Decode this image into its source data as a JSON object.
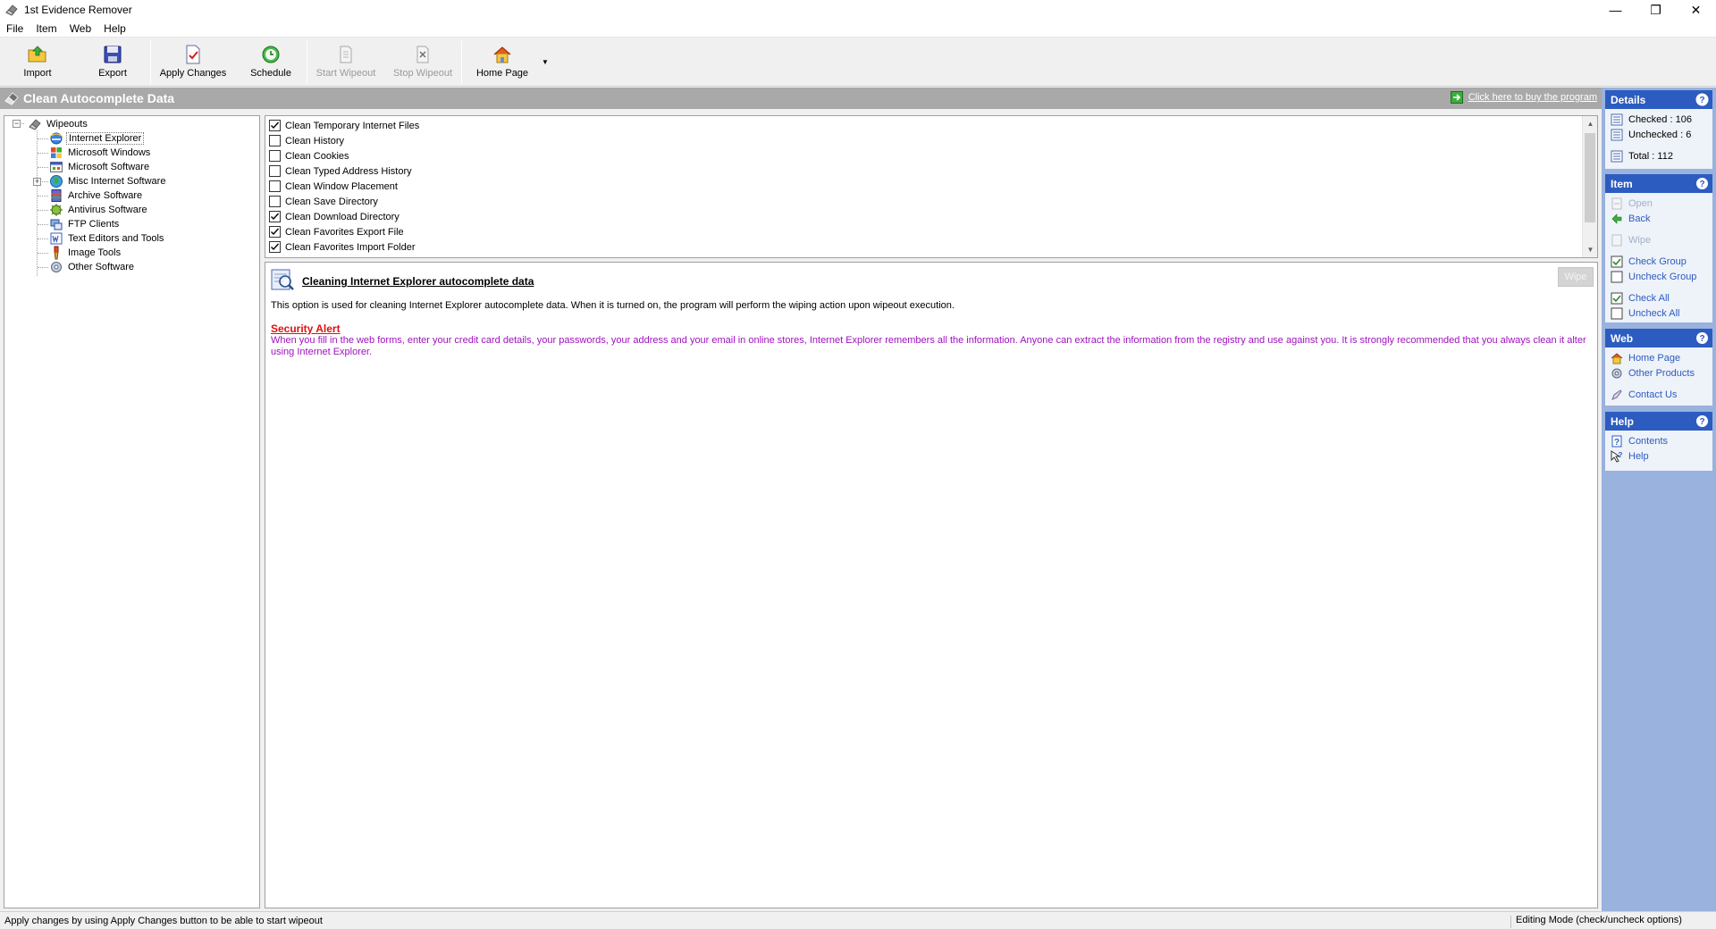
{
  "window": {
    "title": "1st Evidence Remover",
    "minimize_glyph": "—",
    "restore_glyph": "❐",
    "close_glyph": "✕"
  },
  "menu": [
    "File",
    "Item",
    "Web",
    "Help"
  ],
  "toolbar": {
    "import": "Import",
    "export": "Export",
    "apply_changes": "Apply Changes",
    "schedule": "Schedule",
    "start_wipeout": "Start Wipeout",
    "stop_wipeout": "Stop Wipeout",
    "home_page": "Home Page",
    "dropdown_glyph": "▼"
  },
  "header": {
    "title": "Clean Autocomplete Data",
    "buy_link": "Click here to buy the program"
  },
  "tree": {
    "root": "Wipeouts",
    "items": [
      {
        "label": "Internet Explorer",
        "icon": "ie-icon",
        "selected": true
      },
      {
        "label": "Microsoft Windows",
        "icon": "windows-icon"
      },
      {
        "label": "Microsoft Software",
        "icon": "ms-software-icon"
      },
      {
        "label": "Misc Internet Software",
        "icon": "globe-icon",
        "expandable": true
      },
      {
        "label": "Archive Software",
        "icon": "archive-icon"
      },
      {
        "label": "Antivirus Software",
        "icon": "antivirus-icon"
      },
      {
        "label": "FTP Clients",
        "icon": "ftp-icon"
      },
      {
        "label": "Text Editors and Tools",
        "icon": "text-editor-icon"
      },
      {
        "label": "Image Tools",
        "icon": "image-tools-icon"
      },
      {
        "label": "Other Software",
        "icon": "other-software-icon"
      }
    ],
    "collapse_glyph": "−",
    "expand_glyph": "+"
  },
  "checklist": [
    {
      "label": "Clean Temporary Internet Files",
      "checked": true
    },
    {
      "label": "Clean History",
      "checked": false
    },
    {
      "label": "Clean Cookies",
      "checked": false
    },
    {
      "label": "Clean Typed Address History",
      "checked": false
    },
    {
      "label": "Clean Window Placement",
      "checked": false
    },
    {
      "label": "Clean Save Directory",
      "checked": false
    },
    {
      "label": "Clean Download Directory",
      "checked": true
    },
    {
      "label": "Clean Favorites Export File",
      "checked": true
    },
    {
      "label": "Clean Favorites Import Folder",
      "checked": true
    }
  ],
  "scroll": {
    "up_glyph": "▲",
    "down_glyph": "▼"
  },
  "description": {
    "title": "Cleaning Internet Explorer autocomplete data",
    "wipe_button": "Wipe",
    "text": "This option is used for cleaning Internet Explorer autocomplete data. When it is turned on, the program will perform the wiping action upon wipeout execution.",
    "alert_title": "Security Alert",
    "alert_text": "When you fill in the web forms, enter your credit card details, your passwords, your address and your email in online stores, Internet Explorer remembers all the information. Anyone can extract the information from the registry and use against you. It is strongly recommended that you always clean it alter using Internet Explorer."
  },
  "side": {
    "details": {
      "title": "Details",
      "checked": "Checked : 106",
      "unchecked": "Unchecked : 6",
      "total": "Total : 112"
    },
    "item": {
      "title": "Item",
      "open": "Open",
      "back": "Back",
      "wipe": "Wipe",
      "check_group": "Check Group",
      "uncheck_group": "Uncheck Group",
      "check_all": "Check All",
      "uncheck_all": "Uncheck All"
    },
    "web": {
      "title": "Web",
      "home_page": "Home Page",
      "other_products": "Other Products",
      "contact_us": "Contact Us"
    },
    "help": {
      "title": "Help",
      "contents": "Contents",
      "help": "Help"
    }
  },
  "status": {
    "left": "Apply changes by using Apply Changes button to be able to start wipeout",
    "right": "Editing Mode (check/uncheck options)"
  },
  "colors": {
    "header_bg": "#a9a9a9",
    "side_bg": "#99b2de",
    "side_head": "#2c5cc0",
    "alert_red": "#e01010",
    "alert_purple": "#a010c0"
  }
}
